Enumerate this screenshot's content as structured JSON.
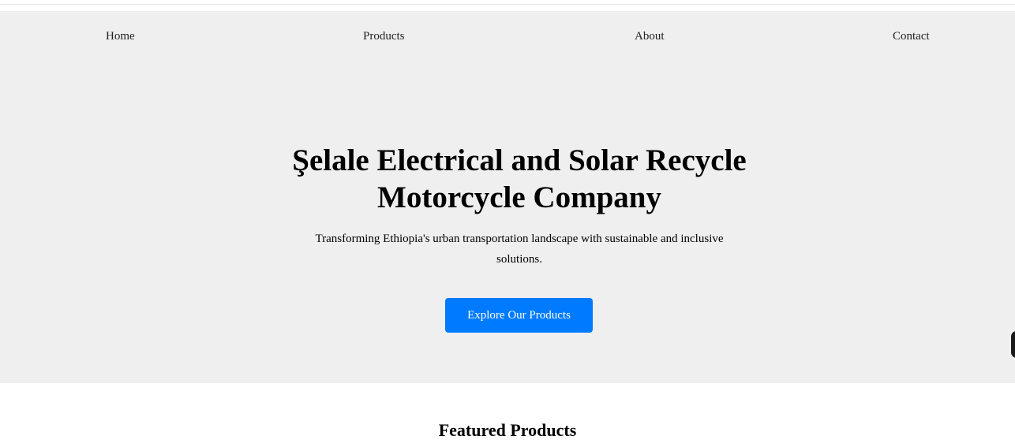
{
  "nav": {
    "items": [
      {
        "label": "Home"
      },
      {
        "label": "Products"
      },
      {
        "label": "About"
      },
      {
        "label": "Contact"
      }
    ]
  },
  "hero": {
    "title": "Şelale Electrical and Solar Recycle Motorcycle Company",
    "subtitle": "Transforming Ethiopia's urban transportation landscape with sustainable and inclusive solutions.",
    "cta_label": "Explore Our Products"
  },
  "featured": {
    "heading": "Featured Products"
  },
  "colors": {
    "hero_background": "#efefef",
    "accent": "#007bff"
  }
}
